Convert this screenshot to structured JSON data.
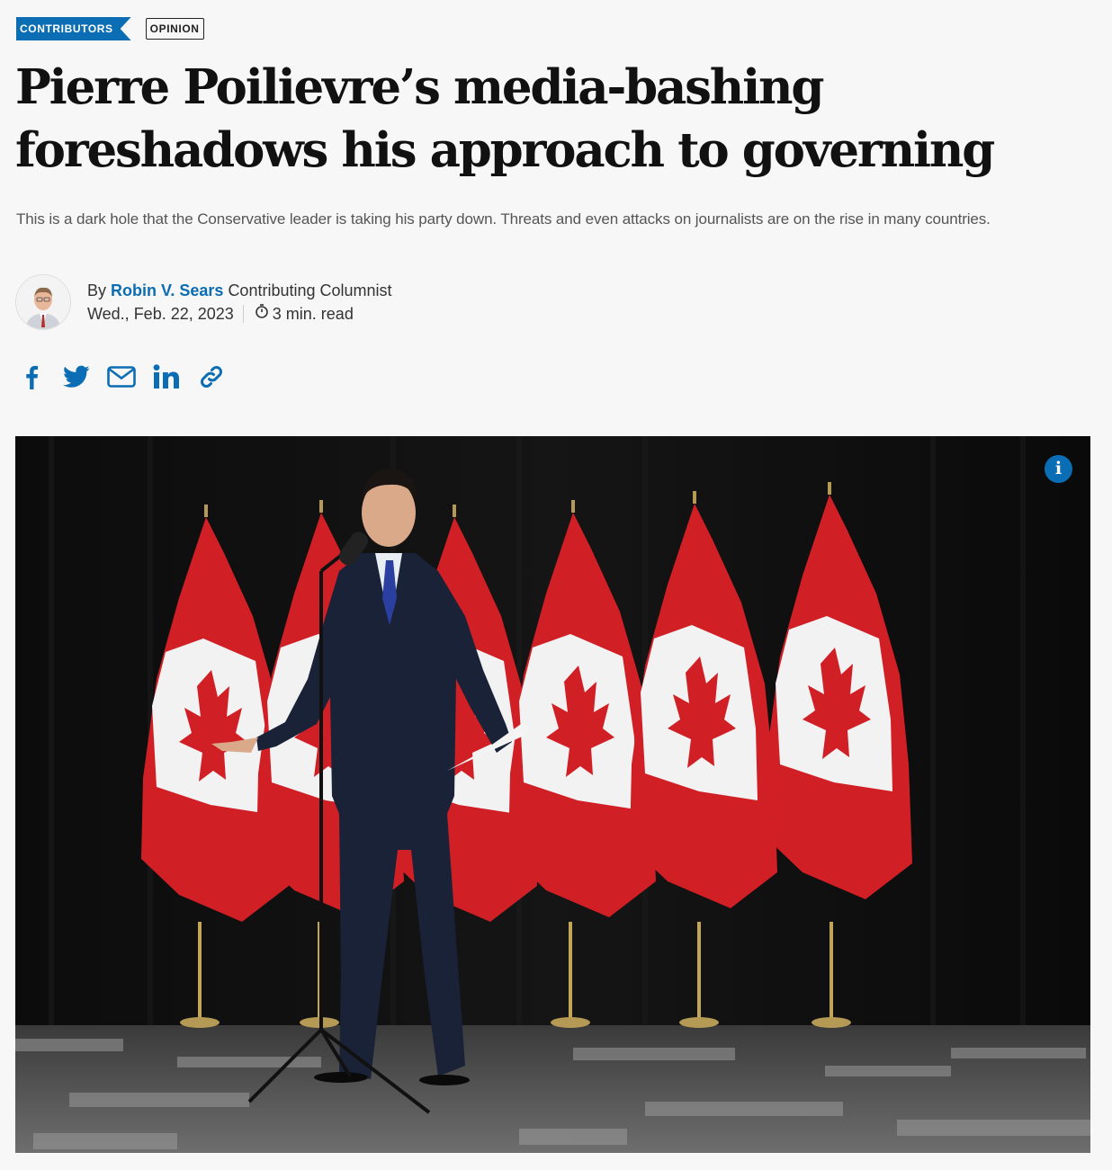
{
  "tags": {
    "section": "CONTRIBUTORS",
    "type": "OPINION"
  },
  "headline": "Pierre Poilievre’s media-bashing foreshadows his approach to governing",
  "deck": "This is a dark hole that the Conservative leader is taking his party down. Threats and even attacks on journalists are on the rise in many countries.",
  "byline": {
    "prefix": "By",
    "author": "Robin V. Sears",
    "role": "Contributing Columnist"
  },
  "meta": {
    "date": "Wed., Feb. 22, 2023",
    "read_time": "3 min. read"
  },
  "share_icons": [
    "facebook-icon",
    "twitter-icon",
    "email-icon",
    "linkedin-icon",
    "link-icon"
  ],
  "hero": {
    "info_label": "i"
  },
  "colors": {
    "accent": "#0b6db3",
    "flag_red": "#d11f26"
  }
}
